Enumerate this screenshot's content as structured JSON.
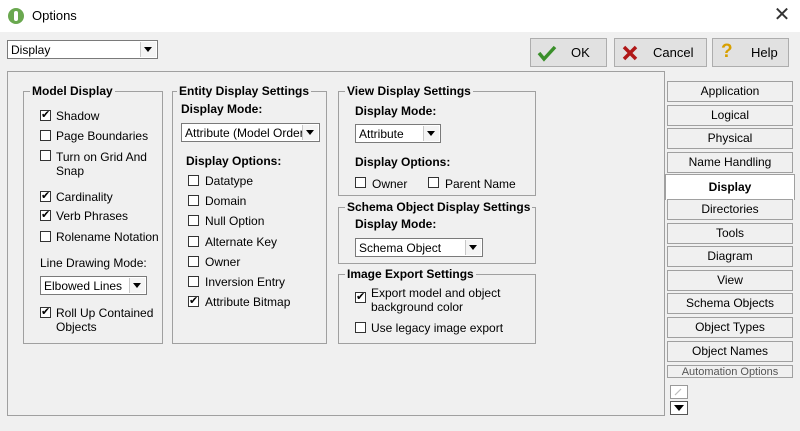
{
  "window": {
    "title": "Options",
    "close_icon": "close-icon"
  },
  "category_select": {
    "value": "Display"
  },
  "buttons": {
    "ok": "OK",
    "cancel": "Cancel",
    "help": "Help"
  },
  "model_display": {
    "title": "Model Display",
    "shadow": {
      "label": "Shadow",
      "checked": true
    },
    "page_boundaries": {
      "label": "Page Boundaries",
      "checked": false
    },
    "grid": {
      "label1": "Turn on Grid And",
      "label2": "Snap",
      "checked": false
    },
    "cardinality": {
      "label": "Cardinality",
      "checked": true
    },
    "verb_phrases": {
      "label": "Verb Phrases",
      "checked": true
    },
    "rolename": {
      "label": "Rolename Notation",
      "checked": false
    },
    "line_mode_label": "Line Drawing Mode:",
    "line_mode_value": "Elbowed Lines",
    "rollup": {
      "label1": "Roll Up Contained",
      "label2": "Objects",
      "checked": true
    }
  },
  "entity_display": {
    "title": "Entity Display Settings",
    "mode_label": "Display Mode:",
    "mode_value": "Attribute (Model Order)",
    "options_label": "Display Options:",
    "options": [
      {
        "label": "Datatype",
        "checked": false
      },
      {
        "label": "Domain",
        "checked": false
      },
      {
        "label": "Null Option",
        "checked": false
      },
      {
        "label": "Alternate Key",
        "checked": false
      },
      {
        "label": "Owner",
        "checked": false
      },
      {
        "label": "Inversion Entry",
        "checked": false
      },
      {
        "label": "Attribute Bitmap",
        "checked": true
      }
    ]
  },
  "view_display": {
    "title": "View Display Settings",
    "mode_label": "Display Mode:",
    "mode_value": "Attribute",
    "options_label": "Display Options:",
    "owner": {
      "label": "Owner",
      "checked": false
    },
    "parent_name": {
      "label": "Parent Name",
      "checked": false
    }
  },
  "schema_display": {
    "title": "Schema Object Display Settings",
    "mode_label": "Display Mode:",
    "mode_value": "Schema Object"
  },
  "image_export": {
    "title": "Image Export Settings",
    "export": {
      "label1": "Export model and object",
      "label2": "background color",
      "checked": true
    },
    "legacy": {
      "label": "Use legacy image export",
      "checked": false
    }
  },
  "tabs": [
    "Application",
    "Logical",
    "Physical",
    "Name Handling",
    "Display",
    "Directories",
    "Tools",
    "Diagram",
    "View",
    "Schema Objects",
    "Object Types",
    "Object Names",
    "Automation Options"
  ],
  "selected_tab": "Display"
}
